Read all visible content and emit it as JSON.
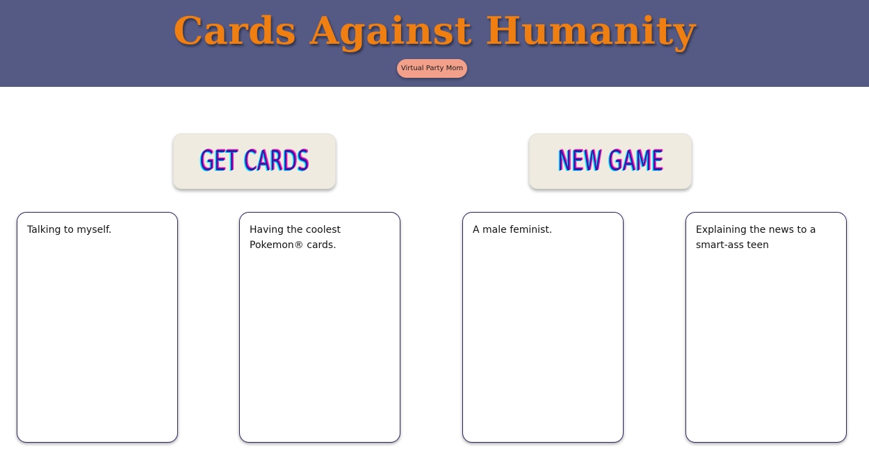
{
  "header": {
    "title": "Cards Against Humanity",
    "subtitle": "Virtual Party Mom",
    "background_color": "#555a84",
    "title_color": "#f07f12",
    "pill_color": "#f3a08b"
  },
  "actions": {
    "get_cards_label": "Get Cards",
    "new_game_label": "New Game"
  },
  "cards": [
    {
      "text": "Talking to myself."
    },
    {
      "text": "Having the coolest Pokemon® cards."
    },
    {
      "text": "A male feminist."
    },
    {
      "text": "Explaining the news to a smart-ass teen"
    }
  ]
}
